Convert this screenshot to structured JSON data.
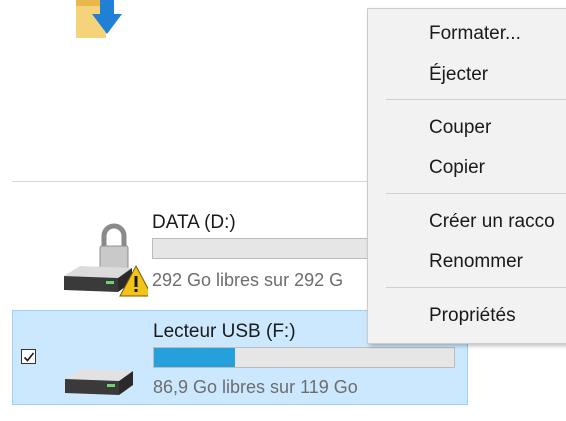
{
  "context_menu": {
    "items": [
      {
        "label": "Formater..."
      },
      {
        "label": "Éjecter"
      },
      {
        "label": "Couper"
      },
      {
        "label": "Copier"
      },
      {
        "label": "Créer un racco"
      },
      {
        "label": "Renommer"
      },
      {
        "label": "Propriétés"
      }
    ]
  },
  "drives": [
    {
      "name": "DATA (D:)",
      "free_text": "292 Go libres sur 292 G",
      "used_fraction": 0.0,
      "warning": true,
      "locked": true,
      "selected": false
    },
    {
      "name": "Lecteur USB (F:)",
      "free_text": "86,9 Go libres sur 119 Go",
      "used_fraction": 0.27,
      "warning": false,
      "locked": false,
      "selected": true
    }
  ],
  "colors": {
    "selection_bg": "#cce8ff",
    "usage_bar": "#26a0da",
    "menu_bg": "#f2f2f2"
  }
}
